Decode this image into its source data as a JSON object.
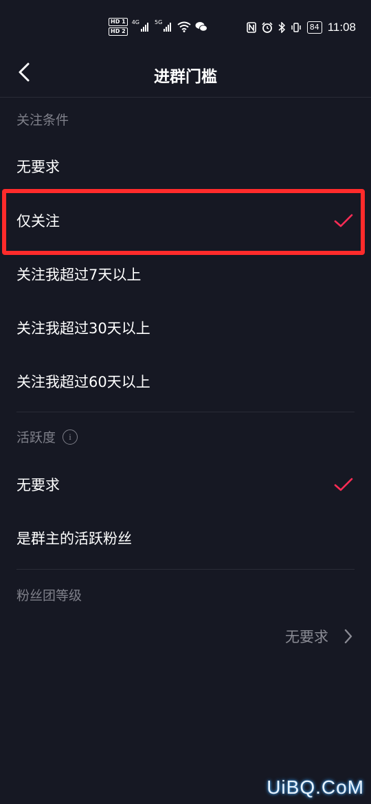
{
  "status_bar": {
    "hd1": "HD 1",
    "hd2": "HD 2",
    "net1": "4G",
    "net2": "5G",
    "battery": "84",
    "time": "11:08"
  },
  "header": {
    "title": "进群门槛"
  },
  "follow_section": {
    "title": "关注条件",
    "options": [
      {
        "label": "无要求",
        "selected": false
      },
      {
        "label": "仅关注",
        "selected": true
      },
      {
        "label": "关注我超过7天以上",
        "selected": false
      },
      {
        "label": "关注我超过30天以上",
        "selected": false
      },
      {
        "label": "关注我超过60天以上",
        "selected": false
      }
    ]
  },
  "activity_section": {
    "title": "活跃度",
    "info_glyph": "i",
    "options": [
      {
        "label": "无要求",
        "selected": true
      },
      {
        "label": "是群主的活跃粉丝",
        "selected": false
      }
    ]
  },
  "fan_section": {
    "title": "粉丝团等级",
    "value": "无要求"
  },
  "watermark": "UiBQ.CoM",
  "colors": {
    "background": "#161823",
    "check": "#fe2c55",
    "highlight": "#ff2b2b",
    "muted_text": "#7f808a"
  }
}
